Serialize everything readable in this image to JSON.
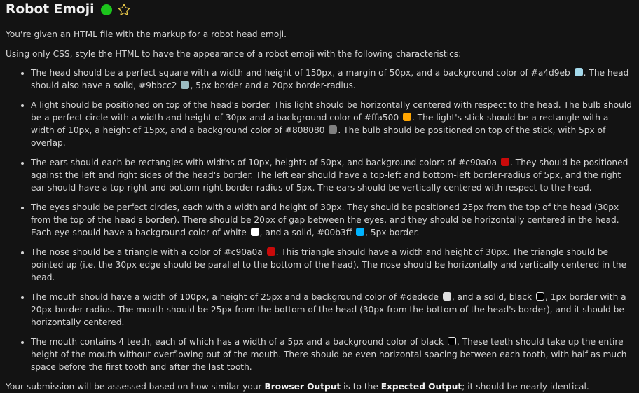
{
  "header": {
    "title": "Robot Emoji"
  },
  "intro": "You're given an HTML file with the markup for a robot head emoji.",
  "intro2": "Using only CSS, style the HTML to have the appearance of a robot emoji with the following characteristics:",
  "colors": {
    "status": "#1cc41c",
    "star_outline": "#e8c84a",
    "head": "#a4d9eb",
    "head_border": "#9bbcc2",
    "bulb": "#ffa500",
    "stick": "#808080",
    "ears": "#c90a0a",
    "eye_fill": "#ffffff",
    "eye_border": "#00b3ff",
    "nose": "#c90a0a",
    "mouth": "#dedede",
    "black": "#000000"
  },
  "requirements": {
    "head": {
      "t1": "The head should be a perfect square with a width and height of 150px, a margin of 50px, and a background color of #a4d9eb",
      "t2": ". The head should also have a solid, #9bbcc2",
      "t3": ", 5px border and a 20px border-radius."
    },
    "light": {
      "t1": "A light should be positioned on top of the head's border. This light should be horizontally centered with respect to the head. The bulb should be a perfect circle with a width and height of 30px and a background color of #ffa500",
      "t2": ". The light's stick should be a rectangle with a width of 10px, a height of 15px, and a background color of #808080",
      "t3": ". The bulb should be positioned on top of the stick, with 5px of overlap."
    },
    "ears": {
      "t1": "The ears should each be rectangles with widths of 10px, heights of 50px, and background colors of #c90a0a",
      "t2": ". They should be positioned against the left and right sides of the head's border. The left ear should have a top-left and bottom-left border-radius of 5px, and the right ear should have a top-right and bottom-right border-radius of 5px. The ears should be vertically centered with respect to the head."
    },
    "eyes": {
      "t1": "The eyes should be perfect circles, each with a width and height of 30px. They should be positioned 25px from the top of the head (30px from the top of the head's border). There should be 20px of gap between the eyes, and they should be horizontally centered in the head. Each eye should have a background color of white",
      "t2": ", and a solid, #00b3ff",
      "t3": ", 5px border."
    },
    "nose": {
      "t1": "The nose should be a triangle with a color of #c90a0a",
      "t2": ". This triangle should have a width and height of 30px. The triangle should be pointed up (i.e. the 30px edge should be parallel to the bottom of the head). The nose should be horizontally and vertically centered in the head."
    },
    "mouth": {
      "t1": "The mouth should have a width of 100px, a height of 25px and a background color of #dedede",
      "t2": ", and a solid, black",
      "t3": ", 1px border with a 20px border-radius. The mouth should be 25px from the bottom of the head (30px from the bottom of the head's border), and it should be horizontally centered."
    },
    "teeth": {
      "t1": "The mouth contains 4 teeth, each of which has a width of a 5px and a background color of black",
      "t2": ". These teeth should take up the entire height of the mouth without overflowing out of the mouth. There should be even horizontal spacing between each tooth, with half as much space before the first tooth and after the last tooth."
    }
  },
  "footer": {
    "t1": "Your submission will be assessed based on how similar your ",
    "b1": "Browser Output",
    "t2": " is to the ",
    "b2": "Expected Output",
    "t3": "; it should be nearly identical."
  }
}
